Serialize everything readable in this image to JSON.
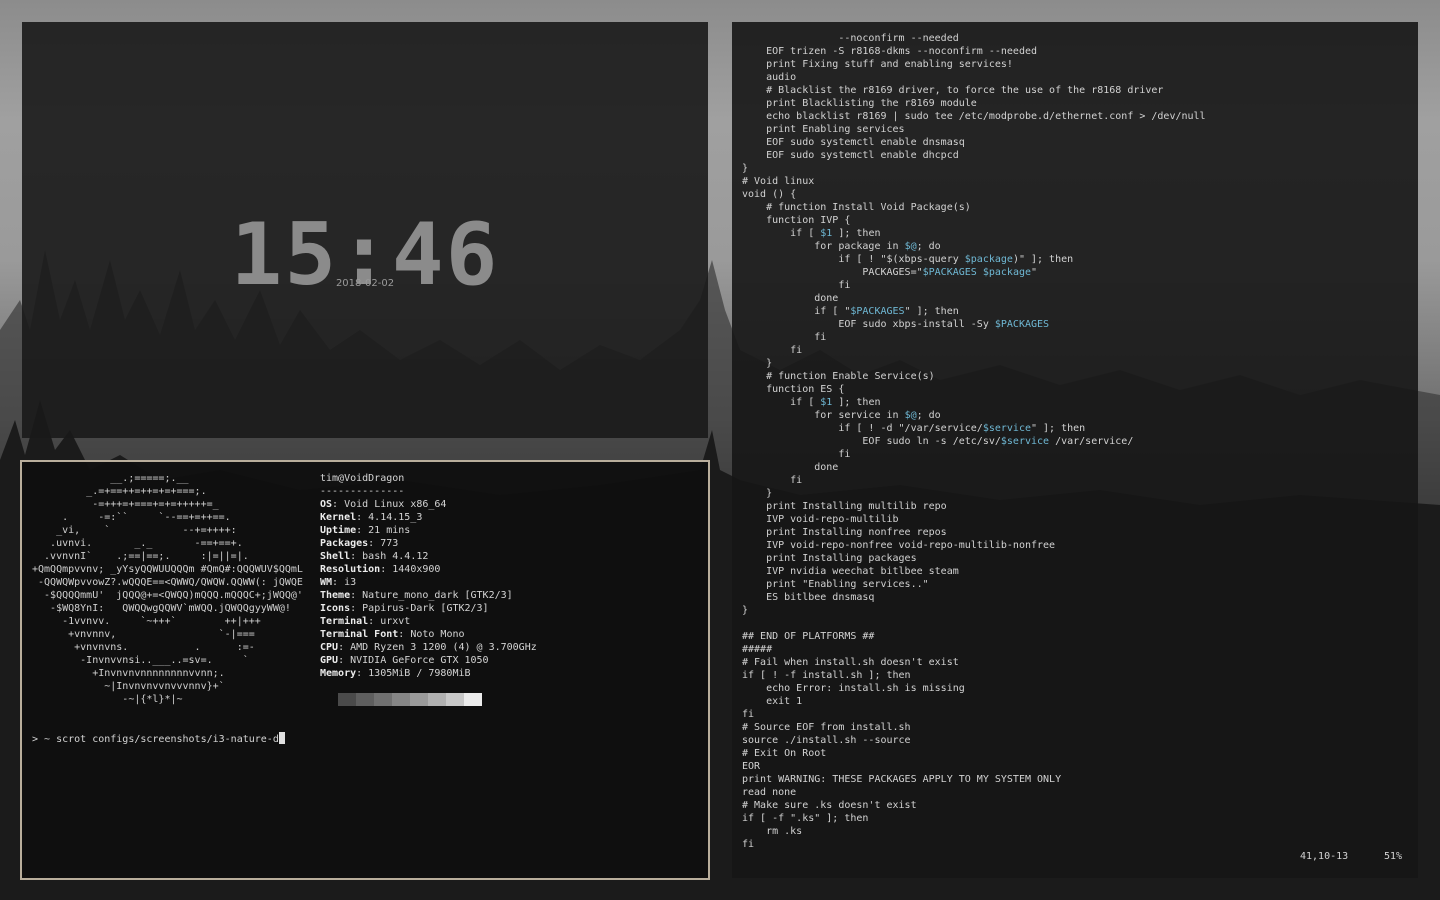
{
  "colors": {
    "accent_border": "#b9ae9c",
    "variable_blue": "#6fb8d4",
    "clock_grey": "#8b8b8b"
  },
  "clock": {
    "time": "15:46",
    "date": "2018-02-02"
  },
  "terminal": {
    "ascii_art": [
      "             __.;=====;.__",
      "         _.=+==++=++=+=+===;.",
      "          -=+++=+===+=+=+++++=_",
      "     .     -=:``     `--==+=++==.",
      "    _vi,    `            --+=++++:",
      "   .uvnvi.       _._       -==+==+.",
      "  .vvnvnI`    .;==|==;.     :|=||=|.",
      "+QmQQmpvvnv; _yYsyQQWUUQQQm #QmQ#:QQQWUV$QQmL",
      " -QQWQWpvvowZ?.wQQQE==<QWWQ/QWQW.QQWW(: jQWQE",
      "  -$QQQQmmU'  jQQQ@+=<QWQQ)mQQQ.mQQQC+;jWQQ@'",
      "   -$WQ8YnI:   QWQQwgQQWV`mWQQ.jQWQQgyyWW@!",
      "     -1vvnvv.     `~+++`        ++|+++",
      "      +vnvnnv,                 `-|===",
      "       +vnvnvns.           .      :=-",
      "        -Invnvvnsi..___..=sv=.     `",
      "          +Invnvnvnnnnnnnnvvnn;.",
      "            ~|Invnvnvvnvvvnnv}+`",
      "               -~|{*l}*|~"
    ],
    "user_host": "tim@VoidDragon",
    "separator": "--------------",
    "info": [
      {
        "key": "OS",
        "value": ": Void Linux x86_64"
      },
      {
        "key": "Kernel",
        "value": ": 4.14.15_3"
      },
      {
        "key": "Uptime",
        "value": ": 21 mins"
      },
      {
        "key": "Packages",
        "value": ": 773"
      },
      {
        "key": "Shell",
        "value": ": bash 4.4.12"
      },
      {
        "key": "Resolution",
        "value": ": 1440x900"
      },
      {
        "key": "WM",
        "value": ": i3"
      },
      {
        "key": "Theme",
        "value": ": Nature_mono_dark [GTK2/3]"
      },
      {
        "key": "Icons",
        "value": ": Papirus-Dark [GTK2/3]"
      },
      {
        "key": "Terminal",
        "value": ": urxvt"
      },
      {
        "key": "Terminal Font",
        "value": ": Noto Mono"
      },
      {
        "key": "CPU",
        "value": ": AMD Ryzen 3 1200 (4) @ 3.700GHz"
      },
      {
        "key": "GPU",
        "value": ": NVIDIA GeForce GTX 1050"
      },
      {
        "key": "Memory",
        "value": ": 1305MiB / 7980MiB"
      }
    ],
    "palette": [
      "#4a4a4a",
      "#5e5e5e",
      "#707070",
      "#858585",
      "#9a9a9a",
      "#b0b0b0",
      "#c8c8c8",
      "#ececec"
    ],
    "prompt": "> ~ scrot configs/screenshots/i3-nature-d"
  },
  "editor": {
    "lines": [
      "                --noconfirm --needed",
      "    EOF trizen -S r8168-dkms --noconfirm --needed",
      "    print Fixing stuff and enabling services!",
      "    audio",
      "    # Blacklist the r8169 driver, to force the use of the r8168 driver",
      "    print Blacklisting the r8169 module",
      "    echo blacklist r8169 | sudo tee /etc/modprobe.d/ethernet.conf > /dev/null",
      "    print Enabling services",
      "    EOF sudo systemctl enable dnsmasq",
      "    EOF sudo systemctl enable dhcpcd",
      "}",
      "# Void linux",
      "void () {",
      "    # function Install Void Package(s)",
      "    function IVP {",
      "        if [ $1 ]; then",
      "            for package in $@; do",
      "                if [ ! \"$(xbps-query $package)\" ]; then",
      "                    PACKAGES=\"$PACKAGES $package\"",
      "                fi",
      "            done",
      "            if [ \"$PACKAGES\" ]; then",
      "                EOF sudo xbps-install -Sy $PACKAGES",
      "            fi",
      "        fi",
      "    }",
      "    # function Enable Service(s)",
      "    function ES {",
      "        if [ $1 ]; then",
      "            for service in $@; do",
      "                if [ ! -d \"/var/service/$service\" ]; then",
      "                    EOF sudo ln -s /etc/sv/$service /var/service/",
      "                fi",
      "            done",
      "        fi",
      "    }",
      "    print Installing multilib repo",
      "    IVP void-repo-multilib",
      "    print Installing nonfree repos",
      "    IVP void-repo-nonfree void-repo-multilib-nonfree",
      "    print Installing packages",
      "    IVP nvidia weechat bitlbee steam",
      "    print \"Enabling services..\"",
      "    ES bitlbee dnsmasq",
      "}",
      "",
      "## END OF PLATFORMS ##",
      "#####",
      "# Fail when install.sh doesn't exist",
      "if [ ! -f install.sh ]; then",
      "    echo Error: install.sh is missing",
      "    exit 1",
      "fi",
      "# Source EOF from install.sh",
      "source ./install.sh --source",
      "# Exit On Root",
      "EOR",
      "print WARNING: THESE PACKAGES APPLY TO MY SYSTEM ONLY",
      "read none",
      "# Make sure .ks doesn't exist",
      "if [ -f \".ks\" ]; then",
      "    rm .ks",
      "fi"
    ],
    "status_position": "41,10-13",
    "status_percent": "51%"
  }
}
